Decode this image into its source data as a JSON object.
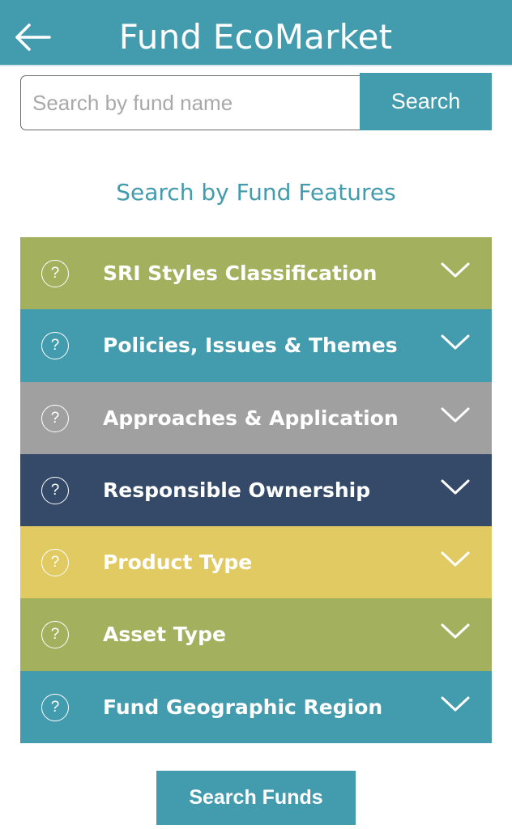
{
  "header": {
    "title": "Fund EcoMarket",
    "back_icon": "arrow-left-icon",
    "background": "#439bae"
  },
  "search": {
    "placeholder": "Search by fund name",
    "value": "",
    "button_label": "Search"
  },
  "section_title": "Search by Fund Features",
  "features": [
    {
      "label": "SRI Styles Classification",
      "color": "#a3b15f",
      "help_icon": "question-circle-icon",
      "toggle_icon": "chevron-down-icon"
    },
    {
      "label": "Policies, Issues & Themes",
      "color": "#439bae",
      "help_icon": "question-circle-icon",
      "toggle_icon": "chevron-down-icon"
    },
    {
      "label": "Approaches & Application",
      "color": "#a0a0a0",
      "help_icon": "question-circle-icon",
      "toggle_icon": "chevron-down-icon"
    },
    {
      "label": "Responsible Ownership",
      "color": "#344a68",
      "help_icon": "question-circle-icon",
      "toggle_icon": "chevron-down-icon"
    },
    {
      "label": "Product Type",
      "color": "#e1ca62",
      "help_icon": "question-circle-icon",
      "toggle_icon": "chevron-down-icon"
    },
    {
      "label": "Asset Type",
      "color": "#a3b15f",
      "help_icon": "question-circle-icon",
      "toggle_icon": "chevron-down-icon"
    },
    {
      "label": "Fund Geographic Region",
      "color": "#439bae",
      "help_icon": "question-circle-icon",
      "toggle_icon": "chevron-down-icon"
    }
  ],
  "help_glyph": "?",
  "submit": {
    "label": "Search Funds"
  }
}
